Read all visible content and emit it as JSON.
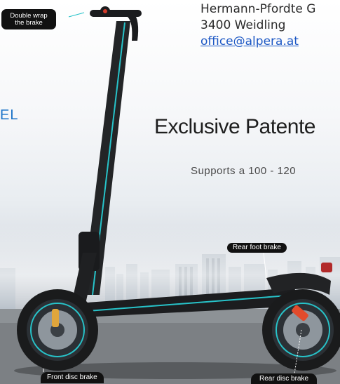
{
  "contact": {
    "street": "Hermann-Pfordte G",
    "city": "3400 Weidling",
    "email": "office@alpera.at"
  },
  "side_label": "EL",
  "headline": "Exclusive Patente",
  "subline": "Supports a 100 - 120",
  "callouts": {
    "double_wrap_line1": "Double wrap",
    "double_wrap_line2": "the brake",
    "rear_foot_brake": "Rear foot brake",
    "front_disc_brake": "Front disc brake",
    "rear_disc_brake": "Rear disc brake"
  },
  "colors": {
    "accent_teal": "#27c3c9",
    "link_blue": "#1b57c4",
    "side_label_blue": "#1b73c8",
    "callout_bg": "#111111",
    "brake_caliper_rear": "#e24b2c",
    "brake_caliper_front": "#e0a63c"
  },
  "icons": [
    "scooter-image",
    "front-wheel-icon",
    "rear-wheel-icon",
    "handlebar-icon"
  ]
}
